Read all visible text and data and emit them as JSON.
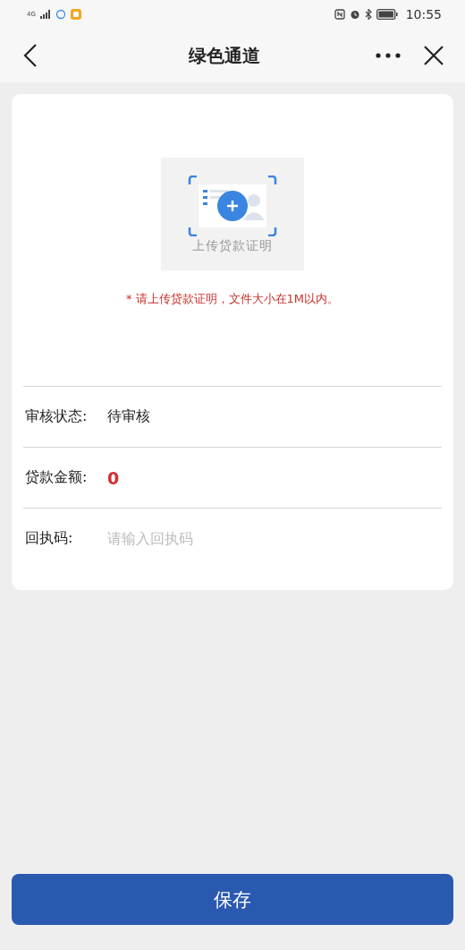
{
  "status_bar": {
    "network": "4G",
    "time": "10:55"
  },
  "nav": {
    "title": "绿色通道"
  },
  "upload": {
    "label": "上传贷款证明",
    "hint": "* 请上传贷款证明，文件大小在1M以内。"
  },
  "fields": [
    {
      "kind": "text",
      "label": "审核状态:",
      "value": "待审核"
    },
    {
      "kind": "amount",
      "label": "贷款金额:",
      "value": "0"
    },
    {
      "kind": "input",
      "label": "回执码:",
      "placeholder": "请输入回执码"
    }
  ],
  "save_button": "保存"
}
